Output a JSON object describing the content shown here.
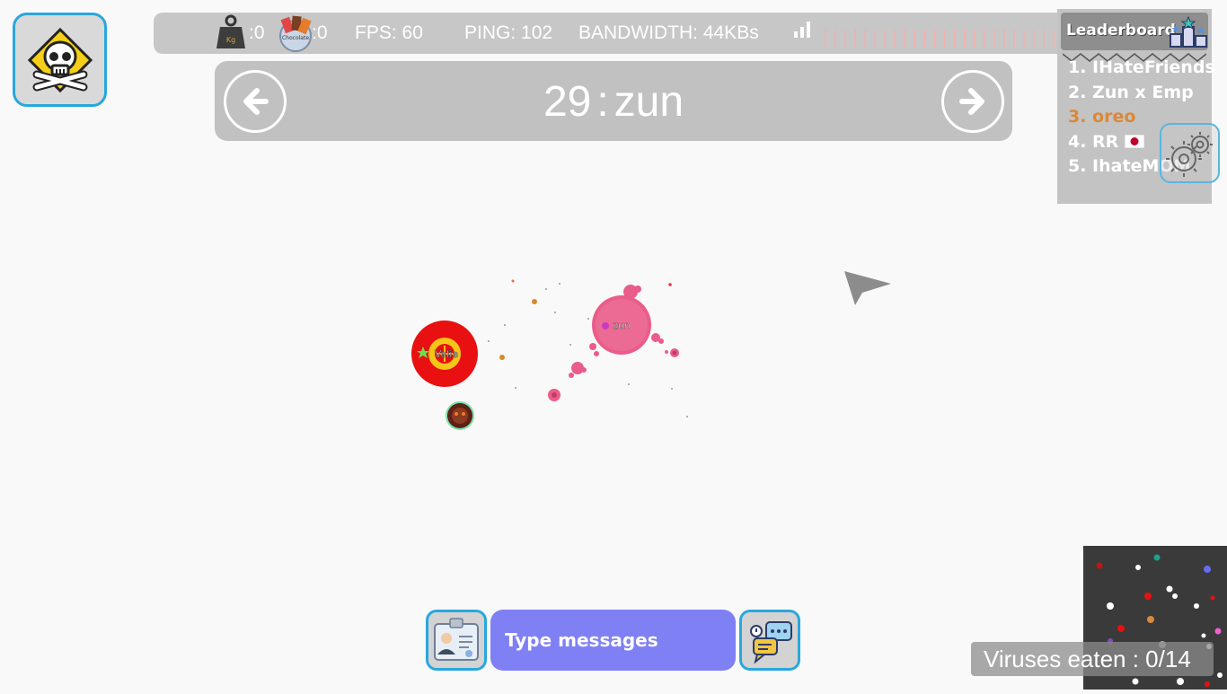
{
  "stats": {
    "mass_count": ":0",
    "chocolate_count": ":0",
    "fps": "FPS: 60",
    "ping": "PING: 102",
    "bandwidth": "BANDWIDTH: 44KBs",
    "bandwidth_bars": "||||||||||||||||||||||||||",
    "weight_icon_text": "Kg",
    "chocolate_icon_text": "Chocolate"
  },
  "spectate": {
    "rank": "29",
    "separator": ":",
    "player_name": "zun"
  },
  "leaderboard": {
    "title": "Leaderboard",
    "entries": [
      {
        "text": "1. IHateFriends",
        "color": "#ffffff"
      },
      {
        "text": "2. Zun x Emp",
        "color": "#ffffff"
      },
      {
        "text": "3. oreo",
        "color": "#d9893a"
      },
      {
        "text": "4. RR",
        "color": "#ffffff"
      },
      {
        "text": "5. IhateMOM",
        "color": "#ffffff"
      }
    ]
  },
  "cells": {
    "player_cell_name": "zun",
    "enemy_cell_name": "Velie"
  },
  "chat": {
    "placeholder": "Type messages"
  },
  "minimap": {
    "viruses_eaten": "Viruses eaten : 0/14"
  },
  "colors": {
    "accent_blue": "#29a7dd",
    "chat_purple": "#8080f5",
    "player_pink": "#ea5c8a",
    "enemy_red": "#e81010",
    "leaderboard_highlight": "#d9893a"
  }
}
